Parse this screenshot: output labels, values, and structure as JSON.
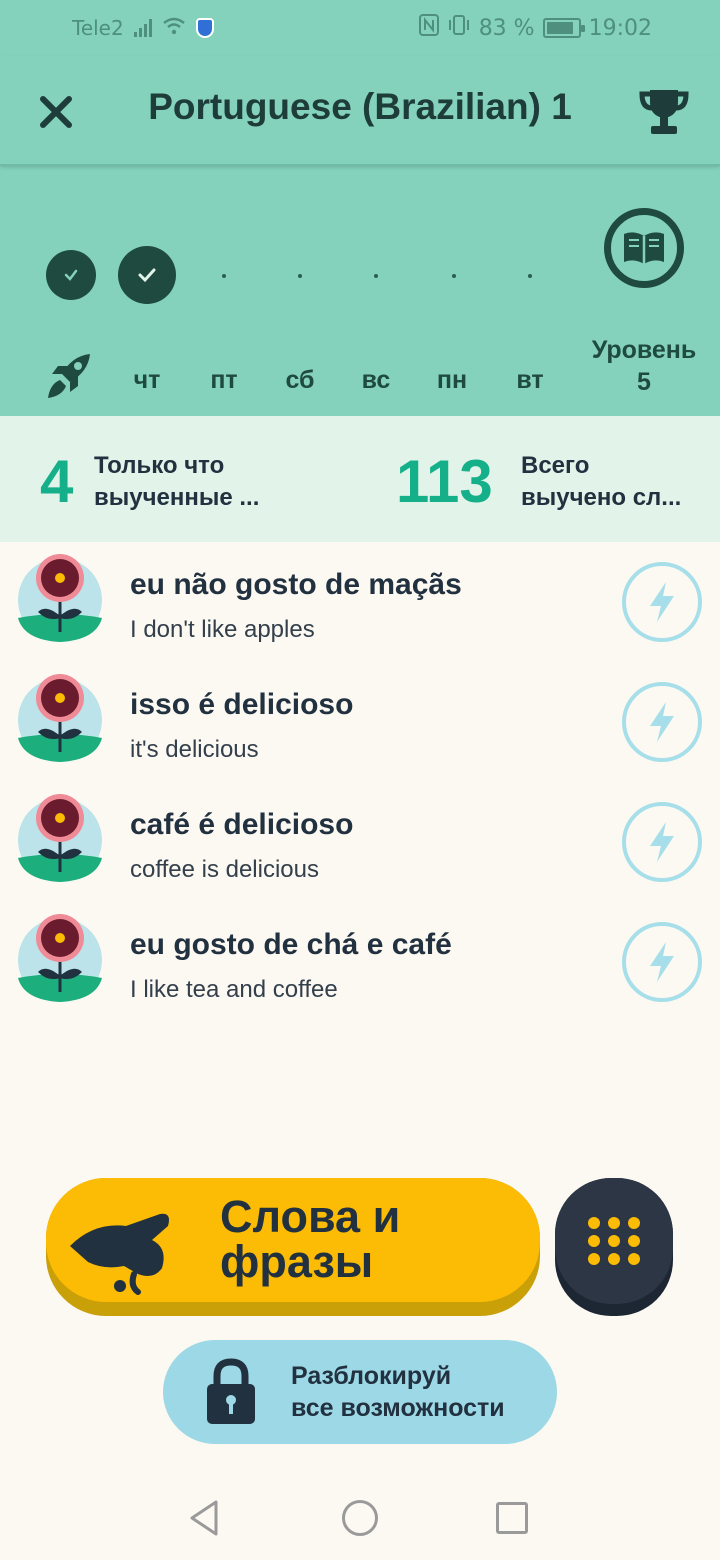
{
  "status_bar": {
    "carrier": "Tele2",
    "battery": "83 %",
    "time": "19:02"
  },
  "header": {
    "title": "Portuguese (Brazilian) 1",
    "close_icon": "close-icon",
    "trophy_icon": "trophy-icon"
  },
  "streak": {
    "days": [
      {
        "label": "чт",
        "completed": true
      },
      {
        "label": "пт",
        "completed": false
      },
      {
        "label": "сб",
        "completed": false
      },
      {
        "label": "вс",
        "completed": false
      },
      {
        "label": "пн",
        "completed": false
      },
      {
        "label": "вт",
        "completed": false
      }
    ],
    "rocket_icon": "rocket-icon",
    "book_icon": "book-icon",
    "level_label": "Уровень",
    "level_value": "5"
  },
  "stats": {
    "recent_count": "4",
    "recent_line1": "Только что",
    "recent_line2": "выученные ...",
    "total_count": "113",
    "total_line1": "Всего",
    "total_line2": "выучено сл..."
  },
  "words": [
    {
      "phrase": "eu não gosto de maçãs",
      "translation": "I don't like apples"
    },
    {
      "phrase": "isso é delicioso",
      "translation": "it's delicious"
    },
    {
      "phrase": "café é delicioso",
      "translation": "coffee is delicious"
    },
    {
      "phrase": "eu gosto de chá e café",
      "translation": "I like tea and coffee"
    }
  ],
  "actions": {
    "learn_line1": "Слова и",
    "learn_line2": "фразы",
    "unlock_line1": "Разблокируй",
    "unlock_line2": "все возможности"
  },
  "colors": {
    "header_bg": "#84d2bb",
    "stats_bg": "#e2f4ea",
    "accent_green": "#15b08a",
    "cta_yellow": "#fcbb05",
    "unlock_blue": "#9dd8e6",
    "dark": "#1f4a40"
  }
}
